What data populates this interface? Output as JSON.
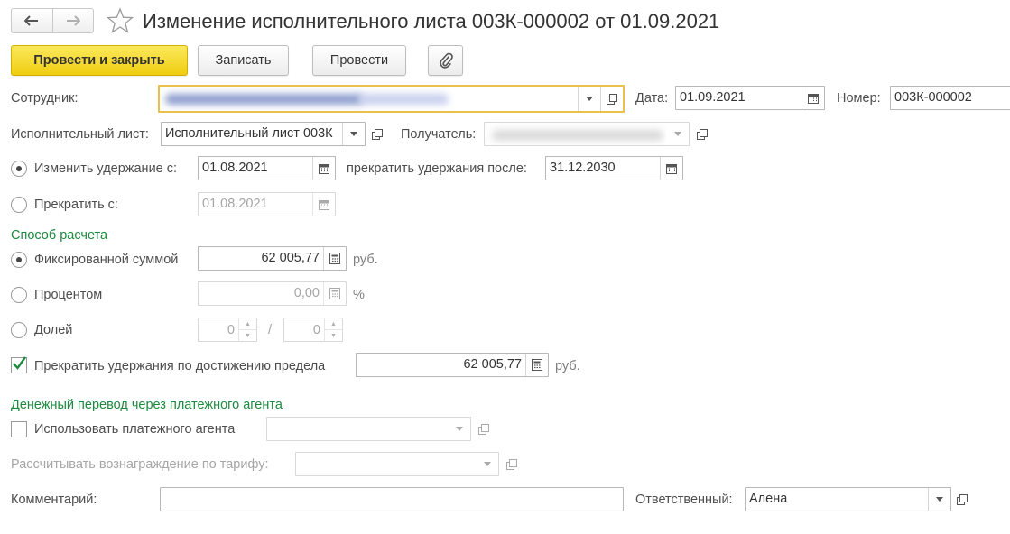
{
  "title": "Изменение исполнительного листа 003К-000002 от 01.09.2021",
  "toolbar": {
    "post_close": "Провести и закрыть",
    "save": "Записать",
    "post": "Провести"
  },
  "employee": {
    "label": "Сотрудник:"
  },
  "date": {
    "label": "Дата:",
    "value": "01.09.2021"
  },
  "number": {
    "label": "Номер:",
    "value": "003К-000002"
  },
  "writ": {
    "label": "Исполнительный лист:",
    "value": "Исполнительный лист 003К"
  },
  "recipient": {
    "label": "Получатель:"
  },
  "change": {
    "label": "Изменить удержание с:",
    "value": "01.08.2021",
    "stop_after_label": "прекратить удержания после:",
    "stop_after_value": "31.12.2030"
  },
  "stop": {
    "label": "Прекратить с:",
    "value": "01.08.2021"
  },
  "calc": {
    "section": "Способ расчета",
    "fixed_label": "Фиксированной суммой",
    "fixed_value": "62 005,77",
    "fixed_unit": "руб.",
    "percent_label": "Процентом",
    "percent_value": "0,00",
    "percent_unit": "%",
    "share_label": "Долей",
    "share_num": "0",
    "share_sep": "/",
    "share_den": "0"
  },
  "limit": {
    "label": "Прекратить удержания по достижению предела",
    "value": "62 005,77",
    "unit": "руб."
  },
  "agent": {
    "section": "Денежный перевод через платежного агента",
    "use_label": "Использовать платежного агента",
    "tariff_label": "Рассчитывать вознаграждение по тарифу:"
  },
  "comment": {
    "label": "Комментарий:",
    "value": ""
  },
  "responsible": {
    "label": "Ответственный:",
    "value": "Алена"
  },
  "colors": {
    "accent": "#f0cd10",
    "section": "#1c8a3d",
    "focus": "#e8c04a"
  }
}
